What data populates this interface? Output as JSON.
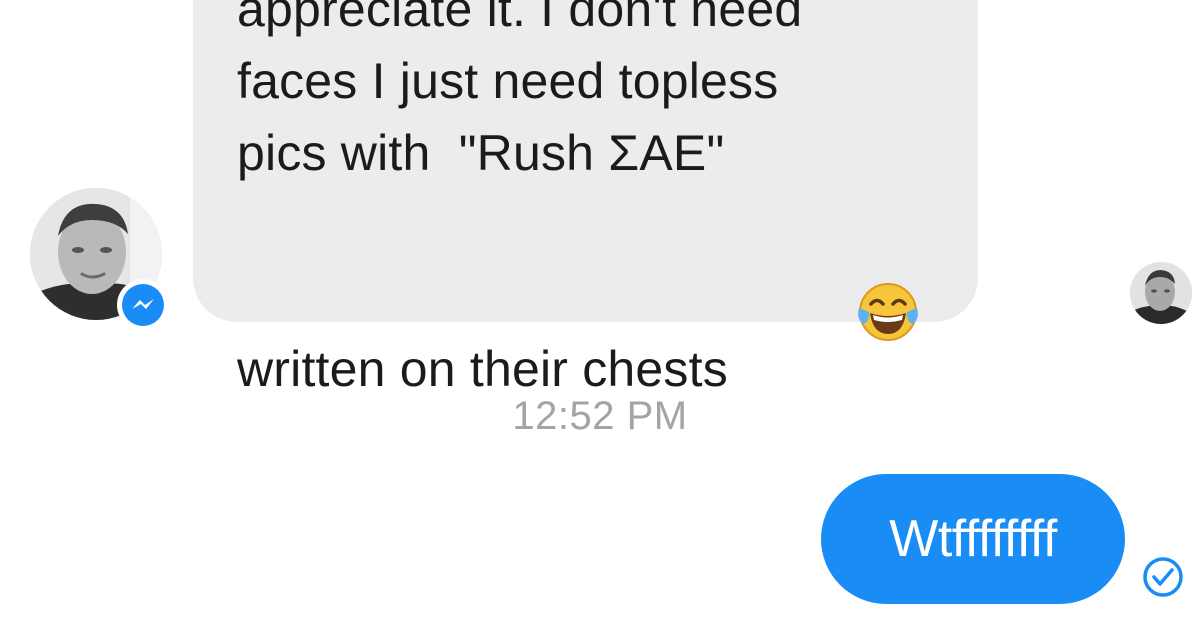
{
  "incoming_message": {
    "lines": [
      "appreciate it. I don't need",
      "faces I just need topless",
      "pics with  \"Rush ΣAE\"",
      "written on their chests"
    ],
    "emoji": "face-with-tears-of-joy-icon"
  },
  "timestamp": "12:52 PM",
  "outgoing_message": {
    "text": "Wtffffffff"
  },
  "icons": {
    "sender_badge": "messenger-icon",
    "sent_status": "check-circle-icon"
  },
  "colors": {
    "incoming_bubble": "#ececec",
    "outgoing_bubble": "#1a8cf5",
    "timestamp_text": "#a4a4a4",
    "messenger_blue": "#1a8cf5"
  }
}
